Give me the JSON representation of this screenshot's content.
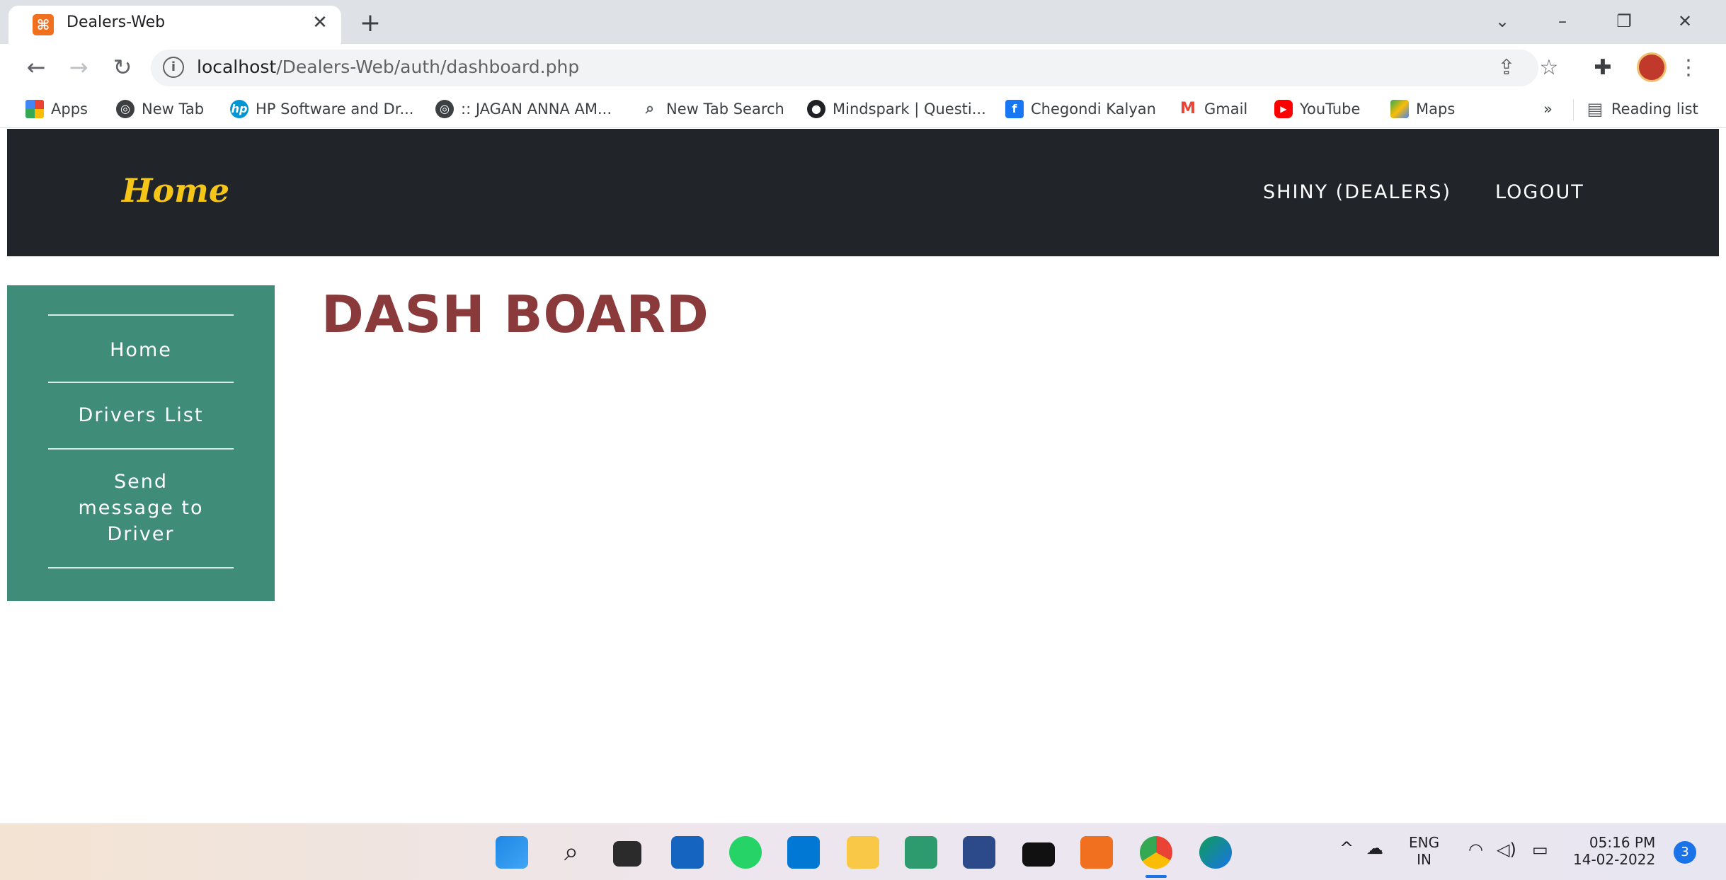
{
  "browser": {
    "tab_title": "Dealers-Web",
    "url_host": "localhost",
    "url_path": "/Dealers-Web/auth/dashboard.php",
    "bookmarks": [
      {
        "label": "Apps",
        "icon": "apps-grid-icon",
        "color": "#ea4335"
      },
      {
        "label": "New Tab",
        "icon": "globe-icon",
        "color": "#3c4043"
      },
      {
        "label": "HP Software and Dr...",
        "icon": "hp-icon",
        "color": "#0096d6"
      },
      {
        "label": ":: JAGAN ANNA AM...",
        "icon": "globe-icon",
        "color": "#3c4043"
      },
      {
        "label": "New Tab Search",
        "icon": "search-icon",
        "color": "#5f6368"
      },
      {
        "label": "Mindspark | Questi...",
        "icon": "mindspark-icon",
        "color": "#202124"
      },
      {
        "label": "Chegondi Kalyan",
        "icon": "facebook-icon",
        "color": "#1877f2"
      },
      {
        "label": "Gmail",
        "icon": "gmail-icon",
        "color": "#ea4335"
      },
      {
        "label": "YouTube",
        "icon": "youtube-icon",
        "color": "#ff0000"
      },
      {
        "label": "Maps",
        "icon": "maps-icon",
        "color": "#34a853"
      }
    ],
    "more_bookmarks": "»",
    "reading_list": "Reading list"
  },
  "site": {
    "brand": "Home",
    "nav": {
      "user": "SHINY (DEALERS)",
      "logout": "LOGOUT"
    },
    "sidebar": {
      "items": [
        {
          "label": "Home"
        },
        {
          "label": "Drivers List"
        },
        {
          "label": "Send message to Driver"
        }
      ]
    },
    "title": "DASH BOARD",
    "colors": {
      "navbar": "#212529",
      "brand": "#f5c518",
      "sidebar": "#3f8c78",
      "title": "#8a3a3a"
    }
  },
  "taskbar": {
    "lang": "ENG",
    "region": "IN",
    "time": "05:16 PM",
    "date": "14-02-2022",
    "notifications": "3"
  }
}
